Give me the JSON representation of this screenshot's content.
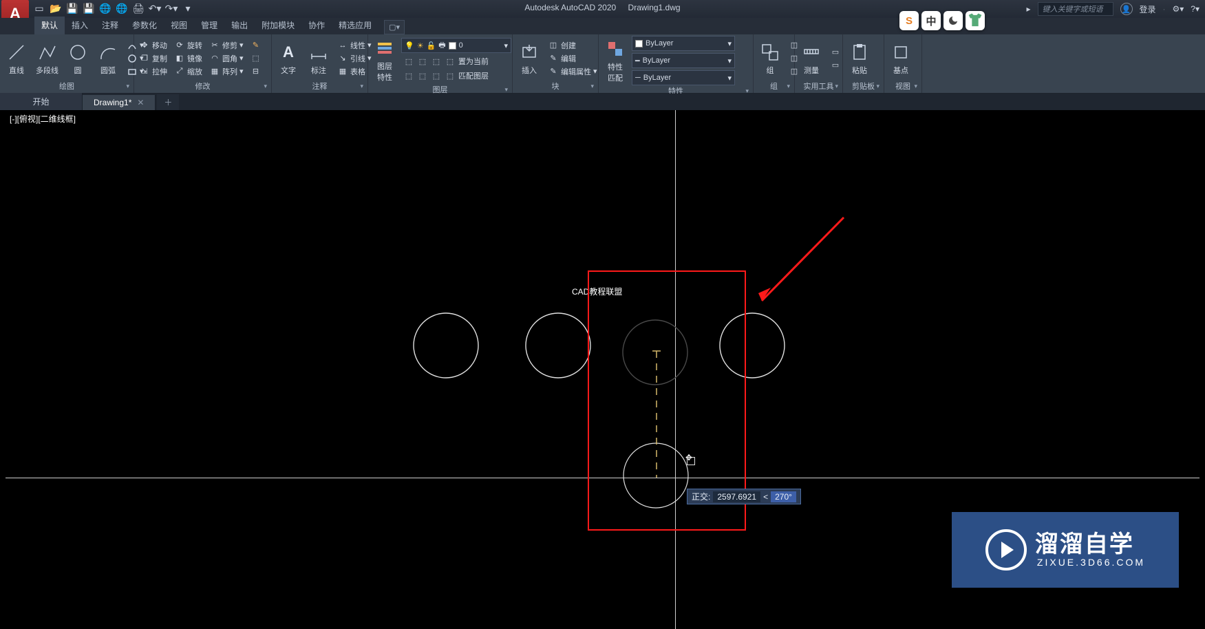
{
  "title": {
    "app": "Autodesk AutoCAD 2020",
    "file": "Drawing1.dwg"
  },
  "search_placeholder": "键入关键字或短语",
  "login_label": "登录",
  "menu_tabs": [
    "默认",
    "插入",
    "注释",
    "参数化",
    "视图",
    "管理",
    "输出",
    "附加模块",
    "协作",
    "精选应用"
  ],
  "active_menu_tab": 0,
  "ribbon": {
    "draw": {
      "title": "绘图",
      "line": "直线",
      "polyline": "多段线",
      "circle": "圆",
      "arc": "圆弧"
    },
    "modify": {
      "title": "修改",
      "move": "移动",
      "rotate": "旋转",
      "trim": "修剪",
      "copy": "复制",
      "mirror": "镜像",
      "fillet": "圆角",
      "stretch": "拉伸",
      "scale": "缩放",
      "array": "阵列"
    },
    "annotate": {
      "title": "注释",
      "text": "文字",
      "dim": "标注",
      "linetype": "线性",
      "leader": "引线",
      "table": "表格"
    },
    "layers": {
      "title": "图层",
      "props": "图层\n特性",
      "current": "0",
      "set_current": "置为当前",
      "match": "匹配图层"
    },
    "blocks": {
      "title": "块",
      "insert": "插入",
      "create": "创建",
      "edit": "编辑",
      "attr": "编辑属性"
    },
    "props": {
      "title": "特性",
      "propmatch": "特性\n匹配",
      "bylayer1": "ByLayer",
      "bylayer2": "ByLayer",
      "bylayer3": "ByLayer"
    },
    "groups": {
      "title": "组",
      "group": "组"
    },
    "utils": {
      "title": "实用工具",
      "measure": "测量"
    },
    "clip": {
      "title": "剪贴板",
      "paste": "粘贴"
    },
    "view": {
      "title": "视图",
      "base": "基点"
    }
  },
  "doc_tabs": {
    "start": "开始",
    "drawing": "Drawing1*",
    "active": 1
  },
  "viewport_label": "[-][俯视][二维线框]",
  "dim_label": "CAD教程联盟",
  "dyn": {
    "prefix": "正交:",
    "dist": "2597.6921",
    "ang": "270°"
  },
  "watermark": {
    "main": "溜溜自学",
    "sub": "ZIXUE.3D66.COM"
  },
  "badges": [
    "S",
    "中",
    "◑",
    "👕"
  ]
}
